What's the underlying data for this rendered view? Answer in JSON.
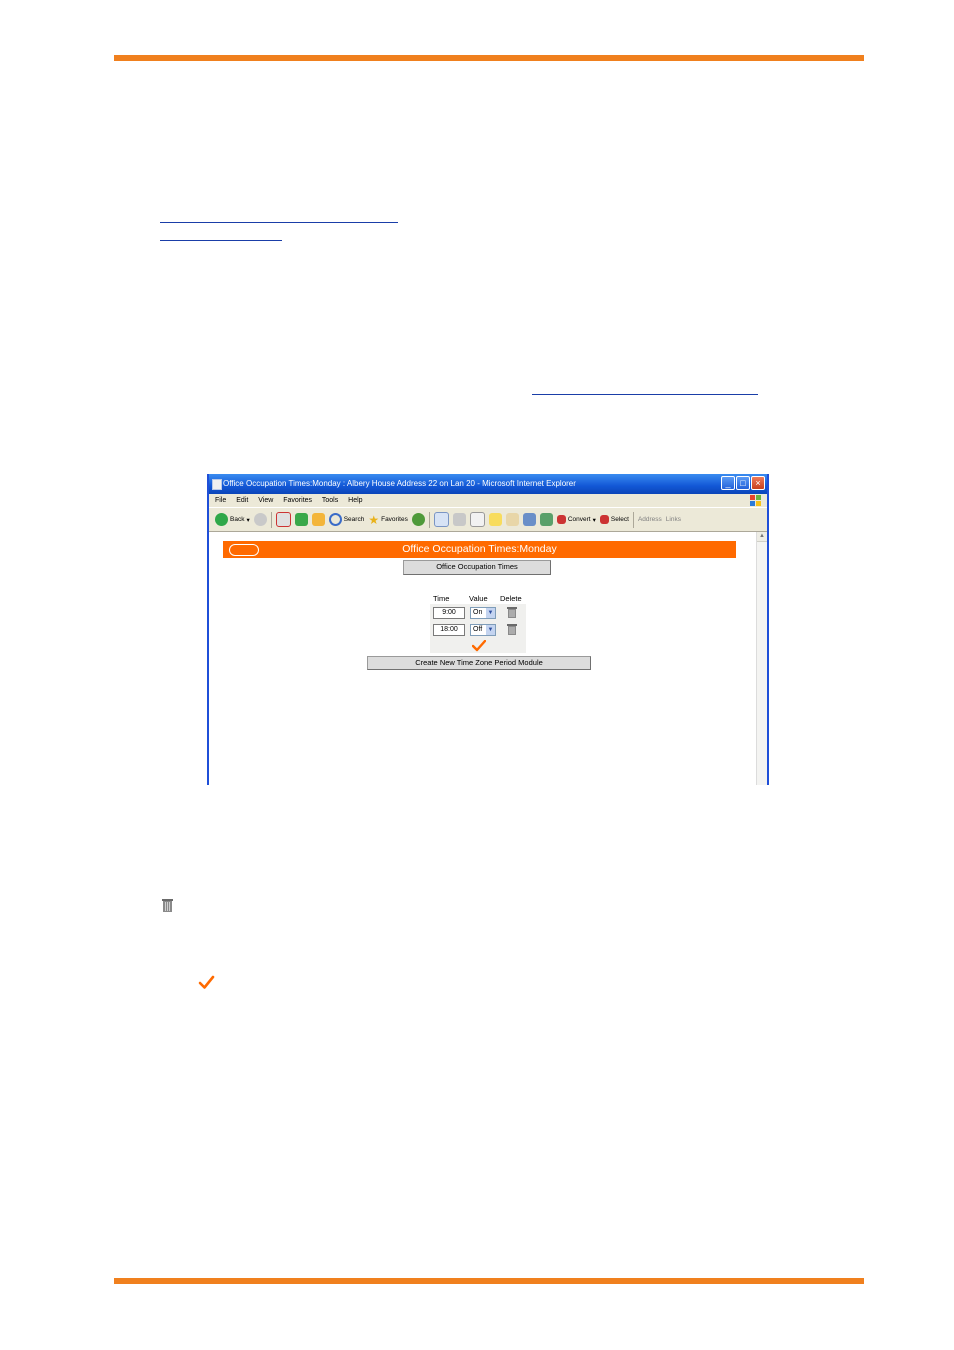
{
  "accent_color": "#f0801e",
  "browser": {
    "title": "Office Occupation Times:Monday : Albery House Address 22 on Lan 20 - Microsoft Internet Explorer",
    "menu": [
      "File",
      "Edit",
      "View",
      "Favorites",
      "Tools",
      "Help"
    ],
    "toolbar": {
      "back": "Back",
      "search": "Search",
      "favorites": "Favorites",
      "convert": "Convert",
      "select": "Select",
      "address": "Address",
      "links": "Links"
    }
  },
  "page": {
    "heading": "Office Occupation Times:Monday",
    "nav_button": "Office Occupation Times",
    "table": {
      "headers": [
        "Time",
        "Value",
        "Delete"
      ],
      "rows": [
        {
          "time": "9:00",
          "value": "On"
        },
        {
          "time": "18:00",
          "value": "Off"
        }
      ]
    },
    "create_button": "Create New Time Zone Period Module"
  }
}
